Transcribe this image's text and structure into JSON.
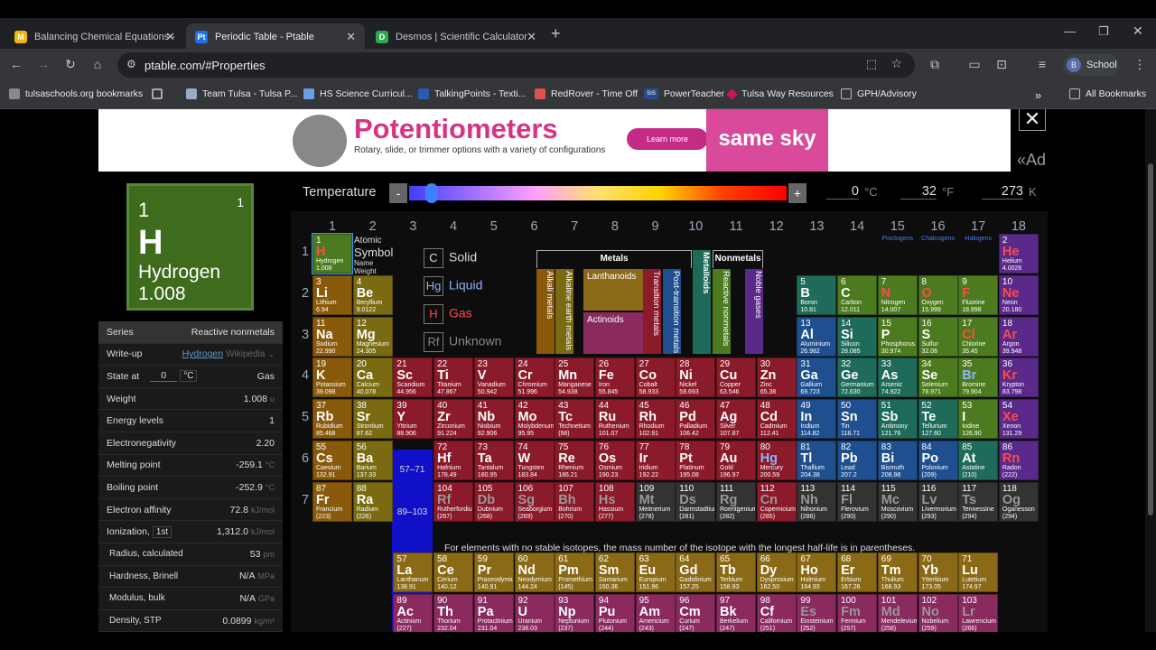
{
  "browser": {
    "tabs": [
      {
        "label": "Balancing Chemical Equations -",
        "icon": "M",
        "color": "#f2b705"
      },
      {
        "label": "Periodic Table - Ptable",
        "icon": "Pt",
        "color": "#1a73e8"
      },
      {
        "label": "Desmos | Scientific Calculator",
        "icon": "D",
        "color": "#2fa84f"
      }
    ],
    "url": "ptable.com/#Properties",
    "profile": "School",
    "bookmarks": [
      "tulsaschools.org bookmarks",
      "Team Tulsa - Tulsa P...",
      "HS Science Curricul...",
      "TalkingPoints - Texti...",
      "RedRover - Time Off",
      "PowerTeacher",
      "Tulsa Way Resources",
      "GPH/Advisory",
      "All Bookmarks"
    ],
    "bookmark_badge": "SIS"
  },
  "ad": {
    "title": "Potentiometers",
    "subtitle": "Rotary, slide, or trimmer options with a variety of configurations",
    "button": "Learn more",
    "brand": "same sky",
    "label": "«Ad",
    "close": "✕"
  },
  "selected": {
    "number": "1",
    "valence": "1",
    "symbol": "H",
    "name": "Hydrogen",
    "weight": "1.008"
  },
  "properties": {
    "series_label": "Series",
    "series_value": "Reactive nonmetals",
    "writeup_label": "Write-up",
    "writeup_link": "Hydrogen",
    "writeup_src": "Wikipedia",
    "state_label": "State at",
    "state_temp": "0",
    "state_unit": "°C",
    "state_value": "Gas",
    "weight_label": "Weight",
    "weight_value": "1.008",
    "weight_unit": "u",
    "energy_label": "Energy levels",
    "energy_value": "1",
    "en_label": "Electronegativity",
    "en_value": "2.20",
    "melt_label": "Melting point",
    "melt_value": "-259.1",
    "melt_unit": "°C",
    "boil_label": "Boiling point",
    "boil_value": "-252.9",
    "boil_unit": "°C",
    "affinity_label": "Electron affinity",
    "affinity_value": "72.8",
    "affinity_unit": "kJ/mol",
    "ion_label": "Ionization,",
    "ion_sel": "1st",
    "ion_value": "1,312.0",
    "ion_unit": "kJ/mol",
    "radius_label": "Radius, calculated",
    "radius_value": "53",
    "radius_unit": "pm",
    "hard_label": "Hardness, Brinell",
    "hard_value": "N/A",
    "hard_unit": "MPa",
    "mod_label": "Modulus, bulk",
    "mod_value": "N/A",
    "mod_unit": "GPa",
    "dens_label": "Density, STP",
    "dens_value": "0.0899",
    "dens_unit": "kg/m³"
  },
  "temp": {
    "label": "Temperature",
    "minus": "-",
    "plus": "+",
    "c": "0",
    "c_unit": "°C",
    "f": "32",
    "f_unit": "°F",
    "k": "273",
    "k_unit": "K",
    "slider_level": 0.06
  },
  "groups": [
    "1",
    "2",
    "3",
    "4",
    "5",
    "6",
    "7",
    "8",
    "9",
    "10",
    "11",
    "12",
    "13",
    "14",
    "15",
    "16",
    "17",
    "18"
  ],
  "group_subs": {
    "15": "Pnictogens",
    "16": "Chalcogens",
    "17": "Halogens"
  },
  "periods": [
    "1",
    "2",
    "3",
    "4",
    "5",
    "6",
    "7"
  ],
  "legend": {
    "atomic": "Atomic",
    "symbol": "Symbol",
    "name": "Name",
    "weight": "Weight",
    "solid": "Solid",
    "liquid": "Liquid",
    "gas": "Gas",
    "unknown": "Unknown",
    "solid_sym": "C",
    "liquid_sym": "Hg",
    "gas_sym": "H",
    "unknown_sym": "Rf"
  },
  "categories": {
    "metals": "Metals",
    "nonmetals": "Nonmetals",
    "metalloids": "Metalloids",
    "alkali": "Alkali metals",
    "alkaline": "Alkaline earth metals",
    "lanthanoids": "Lanthanoids",
    "actinoids": "Actinoids",
    "transition": "Transition metals",
    "post": "Post-transition metals",
    "reactive": "Reactive nonmetals",
    "noble": "Noble gases"
  },
  "fblock": {
    "lan": "57–71",
    "act": "89–103",
    "lanp": "6",
    "actp": "7"
  },
  "note": "For elements with no stable isotopes, the mass number of the isotope with the longest half-life is in parentheses.",
  "colors": {
    "alkali": "#8a5a0c",
    "alkaline": "#7a6a12",
    "transition": "#8b1a2a",
    "post": "#1f4f8f",
    "metalloid": "#1f6b5a",
    "nonmetal": "#4c7a1e",
    "noble": "#5a2a8a",
    "lanthanoid": "#8a6a16",
    "actinoid": "#8a2a5e",
    "unknown": "#333333"
  },
  "elements": [
    [
      "1",
      "H",
      "Hydrogen",
      "1.008",
      1,
      1,
      "nonmetal"
    ],
    [
      "2",
      "He",
      "Helium",
      "4.0026",
      18,
      1,
      "noble"
    ],
    [
      "3",
      "Li",
      "Lithium",
      "6.94",
      1,
      2,
      "alkali"
    ],
    [
      "4",
      "Be",
      "Beryllium",
      "9.0122",
      2,
      2,
      "alkaline"
    ],
    [
      "5",
      "B",
      "Boron",
      "10.81",
      13,
      2,
      "metalloid"
    ],
    [
      "6",
      "C",
      "Carbon",
      "12.011",
      14,
      2,
      "nonmetal"
    ],
    [
      "7",
      "N",
      "Nitrogen",
      "14.007",
      15,
      2,
      "nonmetal"
    ],
    [
      "8",
      "O",
      "Oxygen",
      "15.999",
      16,
      2,
      "nonmetal"
    ],
    [
      "9",
      "F",
      "Fluorine",
      "18.998",
      17,
      2,
      "nonmetal"
    ],
    [
      "10",
      "Ne",
      "Neon",
      "20.180",
      18,
      2,
      "noble"
    ],
    [
      "11",
      "Na",
      "Sodium",
      "22.990",
      1,
      3,
      "alkali"
    ],
    [
      "12",
      "Mg",
      "Magnesium",
      "24.305",
      2,
      3,
      "alkaline"
    ],
    [
      "13",
      "Al",
      "Aluminium",
      "26.982",
      13,
      3,
      "post"
    ],
    [
      "14",
      "Si",
      "Silicon",
      "28.085",
      14,
      3,
      "metalloid"
    ],
    [
      "15",
      "P",
      "Phosphorus",
      "30.974",
      15,
      3,
      "nonmetal"
    ],
    [
      "16",
      "S",
      "Sulfur",
      "32.06",
      16,
      3,
      "nonmetal"
    ],
    [
      "17",
      "Cl",
      "Chlorine",
      "35.45",
      17,
      3,
      "nonmetal"
    ],
    [
      "18",
      "Ar",
      "Argon",
      "39.948",
      18,
      3,
      "noble"
    ],
    [
      "19",
      "K",
      "Potassium",
      "39.098",
      1,
      4,
      "alkali"
    ],
    [
      "20",
      "Ca",
      "Calcium",
      "40.078",
      2,
      4,
      "alkaline"
    ],
    [
      "21",
      "Sc",
      "Scandium",
      "44.956",
      3,
      4,
      "transition"
    ],
    [
      "22",
      "Ti",
      "Titanium",
      "47.867",
      4,
      4,
      "transition"
    ],
    [
      "23",
      "V",
      "Vanadium",
      "50.942",
      5,
      4,
      "transition"
    ],
    [
      "24",
      "Cr",
      "Chromium",
      "51.996",
      6,
      4,
      "transition"
    ],
    [
      "25",
      "Mn",
      "Manganese",
      "54.938",
      7,
      4,
      "transition"
    ],
    [
      "26",
      "Fe",
      "Iron",
      "55.845",
      8,
      4,
      "transition"
    ],
    [
      "27",
      "Co",
      "Cobalt",
      "58.933",
      9,
      4,
      "transition"
    ],
    [
      "28",
      "Ni",
      "Nickel",
      "58.693",
      10,
      4,
      "transition"
    ],
    [
      "29",
      "Cu",
      "Copper",
      "63.546",
      11,
      4,
      "transition"
    ],
    [
      "30",
      "Zn",
      "Zinc",
      "65.38",
      12,
      4,
      "transition"
    ],
    [
      "31",
      "Ga",
      "Gallium",
      "69.723",
      13,
      4,
      "post"
    ],
    [
      "32",
      "Ge",
      "Germanium",
      "72.630",
      14,
      4,
      "metalloid"
    ],
    [
      "33",
      "As",
      "Arsenic",
      "74.922",
      15,
      4,
      "metalloid"
    ],
    [
      "34",
      "Se",
      "Selenium",
      "78.971",
      16,
      4,
      "nonmetal"
    ],
    [
      "35",
      "Br",
      "Bromine",
      "79.904",
      17,
      4,
      "nonmetal"
    ],
    [
      "36",
      "Kr",
      "Krypton",
      "83.798",
      18,
      4,
      "noble"
    ],
    [
      "37",
      "Rb",
      "Rubidium",
      "85.468",
      1,
      5,
      "alkali"
    ],
    [
      "38",
      "Sr",
      "Strontium",
      "87.62",
      2,
      5,
      "alkaline"
    ],
    [
      "39",
      "Y",
      "Yttrium",
      "88.906",
      3,
      5,
      "transition"
    ],
    [
      "40",
      "Zr",
      "Zirconium",
      "91.224",
      4,
      5,
      "transition"
    ],
    [
      "41",
      "Nb",
      "Niobium",
      "92.906",
      5,
      5,
      "transition"
    ],
    [
      "42",
      "Mo",
      "Molybdenum",
      "95.95",
      6,
      5,
      "transition"
    ],
    [
      "43",
      "Tc",
      "Technetium",
      "(98)",
      7,
      5,
      "transition"
    ],
    [
      "44",
      "Ru",
      "Ruthenium",
      "101.07",
      8,
      5,
      "transition"
    ],
    [
      "45",
      "Rh",
      "Rhodium",
      "102.91",
      9,
      5,
      "transition"
    ],
    [
      "46",
      "Pd",
      "Palladium",
      "106.42",
      10,
      5,
      "transition"
    ],
    [
      "47",
      "Ag",
      "Silver",
      "107.87",
      11,
      5,
      "transition"
    ],
    [
      "48",
      "Cd",
      "Cadmium",
      "112.41",
      12,
      5,
      "transition"
    ],
    [
      "49",
      "In",
      "Indium",
      "114.82",
      13,
      5,
      "post"
    ],
    [
      "50",
      "Sn",
      "Tin",
      "118.71",
      14,
      5,
      "post"
    ],
    [
      "51",
      "Sb",
      "Antimony",
      "121.76",
      15,
      5,
      "metalloid"
    ],
    [
      "52",
      "Te",
      "Tellurium",
      "127.60",
      16,
      5,
      "metalloid"
    ],
    [
      "53",
      "I",
      "Iodine",
      "126.90",
      17,
      5,
      "nonmetal"
    ],
    [
      "54",
      "Xe",
      "Xenon",
      "131.29",
      18,
      5,
      "noble"
    ],
    [
      "55",
      "Cs",
      "Caesium",
      "132.91",
      1,
      6,
      "alkali"
    ],
    [
      "56",
      "Ba",
      "Barium",
      "137.33",
      2,
      6,
      "alkaline"
    ],
    [
      "72",
      "Hf",
      "Hafnium",
      "178.49",
      4,
      6,
      "transition"
    ],
    [
      "73",
      "Ta",
      "Tantalum",
      "180.95",
      5,
      6,
      "transition"
    ],
    [
      "74",
      "W",
      "Tungsten",
      "183.84",
      6,
      6,
      "transition"
    ],
    [
      "75",
      "Re",
      "Rhenium",
      "186.21",
      7,
      6,
      "transition"
    ],
    [
      "76",
      "Os",
      "Osmium",
      "190.23",
      8,
      6,
      "transition"
    ],
    [
      "77",
      "Ir",
      "Iridium",
      "192.22",
      9,
      6,
      "transition"
    ],
    [
      "78",
      "Pt",
      "Platinum",
      "195.08",
      10,
      6,
      "transition"
    ],
    [
      "79",
      "Au",
      "Gold",
      "196.97",
      11,
      6,
      "transition"
    ],
    [
      "80",
      "Hg",
      "Mercury",
      "200.59",
      12,
      6,
      "transition"
    ],
    [
      "81",
      "Tl",
      "Thallium",
      "204.38",
      13,
      6,
      "post"
    ],
    [
      "82",
      "Pb",
      "Lead",
      "207.2",
      14,
      6,
      "post"
    ],
    [
      "83",
      "Bi",
      "Bismuth",
      "208.98",
      15,
      6,
      "post"
    ],
    [
      "84",
      "Po",
      "Polonium",
      "(209)",
      16,
      6,
      "post"
    ],
    [
      "85",
      "At",
      "Astatine",
      "(210)",
      17,
      6,
      "metalloid"
    ],
    [
      "86",
      "Rn",
      "Radon",
      "(222)",
      18,
      6,
      "noble"
    ],
    [
      "87",
      "Fr",
      "Francium",
      "(223)",
      1,
      7,
      "alkali"
    ],
    [
      "88",
      "Ra",
      "Radium",
      "(226)",
      2,
      7,
      "alkaline"
    ],
    [
      "104",
      "Rf",
      "Rutherfordium",
      "(267)",
      4,
      7,
      "transition"
    ],
    [
      "105",
      "Db",
      "Dubnium",
      "(268)",
      5,
      7,
      "transition"
    ],
    [
      "106",
      "Sg",
      "Seaborgium",
      "(269)",
      6,
      7,
      "transition"
    ],
    [
      "107",
      "Bh",
      "Bohrium",
      "(270)",
      7,
      7,
      "transition"
    ],
    [
      "108",
      "Hs",
      "Hassium",
      "(277)",
      8,
      7,
      "transition"
    ],
    [
      "109",
      "Mt",
      "Meitnerium",
      "(278)",
      9,
      7,
      "unknown"
    ],
    [
      "110",
      "Ds",
      "Darmstadtium",
      "(281)",
      10,
      7,
      "unknown"
    ],
    [
      "111",
      "Rg",
      "Roentgenium",
      "(282)",
      11,
      7,
      "unknown"
    ],
    [
      "112",
      "Cn",
      "Copernicium",
      "(285)",
      12,
      7,
      "transition"
    ],
    [
      "113",
      "Nh",
      "Nihonium",
      "(286)",
      13,
      7,
      "unknown"
    ],
    [
      "114",
      "Fl",
      "Flerovium",
      "(290)",
      14,
      7,
      "unknown"
    ],
    [
      "115",
      "Mc",
      "Moscovium",
      "(290)",
      15,
      7,
      "unknown"
    ],
    [
      "116",
      "Lv",
      "Livermorium",
      "(293)",
      16,
      7,
      "unknown"
    ],
    [
      "117",
      "Ts",
      "Tennessine",
      "(294)",
      17,
      7,
      "unknown"
    ],
    [
      "118",
      "Og",
      "Oganesson",
      "(294)",
      18,
      7,
      "unknown"
    ],
    [
      "57",
      "La",
      "Lanthanum",
      "138.91",
      3,
      9,
      "lanthanoid"
    ],
    [
      "58",
      "Ce",
      "Cerium",
      "140.12",
      4,
      9,
      "lanthanoid"
    ],
    [
      "59",
      "Pr",
      "Praseodymium",
      "140.91",
      5,
      9,
      "lanthanoid"
    ],
    [
      "60",
      "Nd",
      "Neodymium",
      "144.24",
      6,
      9,
      "lanthanoid"
    ],
    [
      "61",
      "Pm",
      "Promethium",
      "(145)",
      7,
      9,
      "lanthanoid"
    ],
    [
      "62",
      "Sm",
      "Samarium",
      "150.36",
      8,
      9,
      "lanthanoid"
    ],
    [
      "63",
      "Eu",
      "Europium",
      "151.96",
      9,
      9,
      "lanthanoid"
    ],
    [
      "64",
      "Gd",
      "Gadolinium",
      "157.25",
      10,
      9,
      "lanthanoid"
    ],
    [
      "65",
      "Tb",
      "Terbium",
      "158.93",
      11,
      9,
      "lanthanoid"
    ],
    [
      "66",
      "Dy",
      "Dysprosium",
      "162.50",
      12,
      9,
      "lanthanoid"
    ],
    [
      "67",
      "Ho",
      "Holmium",
      "164.93",
      13,
      9,
      "lanthanoid"
    ],
    [
      "68",
      "Er",
      "Erbium",
      "167.26",
      14,
      9,
      "lanthanoid"
    ],
    [
      "69",
      "Tm",
      "Thulium",
      "168.93",
      15,
      9,
      "lanthanoid"
    ],
    [
      "70",
      "Yb",
      "Ytterbium",
      "173.05",
      16,
      9,
      "lanthanoid"
    ],
    [
      "71",
      "Lu",
      "Lutetium",
      "174.97",
      17,
      9,
      "lanthanoid"
    ],
    [
      "89",
      "Ac",
      "Actinium",
      "(227)",
      3,
      10,
      "actinoid"
    ],
    [
      "90",
      "Th",
      "Thorium",
      "232.04",
      4,
      10,
      "actinoid"
    ],
    [
      "91",
      "Pa",
      "Protactinium",
      "231.04",
      5,
      10,
      "actinoid"
    ],
    [
      "92",
      "U",
      "Uranium",
      "238.03",
      6,
      10,
      "actinoid"
    ],
    [
      "93",
      "Np",
      "Neptunium",
      "(237)",
      7,
      10,
      "actinoid"
    ],
    [
      "94",
      "Pu",
      "Plutonium",
      "(244)",
      8,
      10,
      "actinoid"
    ],
    [
      "95",
      "Am",
      "Americium",
      "(243)",
      9,
      10,
      "actinoid"
    ],
    [
      "96",
      "Cm",
      "Curium",
      "(247)",
      10,
      10,
      "actinoid"
    ],
    [
      "97",
      "Bk",
      "Berkelium",
      "(247)",
      11,
      10,
      "actinoid"
    ],
    [
      "98",
      "Cf",
      "Californium",
      "(251)",
      12,
      10,
      "actinoid"
    ],
    [
      "99",
      "Es",
      "Einsteinium",
      "(252)",
      13,
      10,
      "actinoid"
    ],
    [
      "100",
      "Fm",
      "Fermium",
      "(257)",
      14,
      10,
      "actinoid"
    ],
    [
      "101",
      "Md",
      "Mendelevium",
      "(258)",
      15,
      10,
      "actinoid"
    ],
    [
      "102",
      "No",
      "Nobelium",
      "(259)",
      16,
      10,
      "actinoid"
    ],
    [
      "103",
      "Lr",
      "Lawrencium",
      "(266)",
      17,
      10,
      "actinoid"
    ]
  ],
  "symbol_colors": {
    "gas": "#ff4a4a",
    "liquid": "#8fb3ff",
    "solid": "#ffffff",
    "unknown": "#999999"
  },
  "gases": [
    "H",
    "He",
    "N",
    "O",
    "F",
    "Ne",
    "Cl",
    "Ar",
    "Kr",
    "Xe",
    "Rn"
  ],
  "liquids": [
    "Br",
    "Hg"
  ],
  "unknown_state": [
    "Mt",
    "Ds",
    "Rg",
    "Nh",
    "Fl",
    "Mc",
    "Lv",
    "Ts",
    "Og",
    "Cn",
    "Hs",
    "Bh",
    "Sg",
    "Db",
    "Rf",
    "Fm",
    "Md",
    "No",
    "Lr",
    "Es"
  ]
}
